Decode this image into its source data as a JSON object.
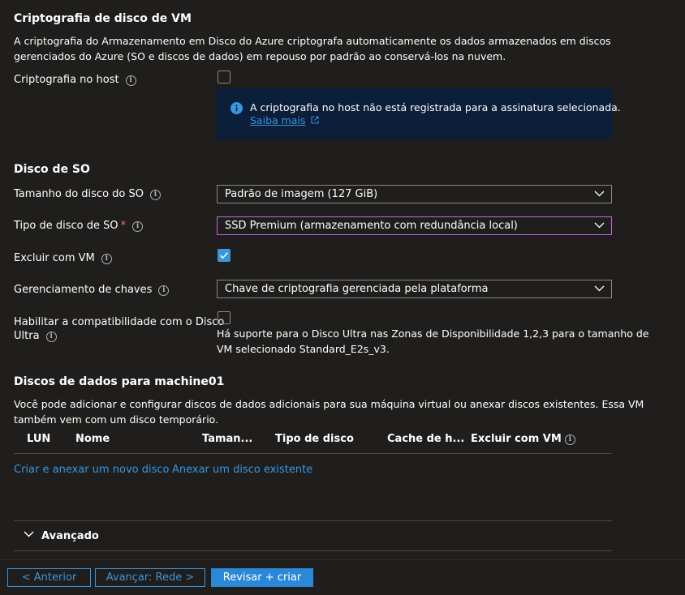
{
  "encryption": {
    "title": "Criptografia de disco de VM",
    "description_line1": "A criptografia do Armazenamento em Disco do Azure criptografa automaticamente os dados armazenados em discos",
    "description_line2": "gerenciados do Azure (SO e discos de dados) em repouso por padrão ao conservá-los na nuvem.",
    "host_label": "Criptografia no host",
    "host_checked": false,
    "info_message": "A criptografia no host não está registrada para a assinatura selecionada.",
    "info_link": "Saiba mais"
  },
  "os_disk": {
    "title": "Disco de SO",
    "size_label": "Tamanho do disco do SO",
    "size_value": "Padrão de imagem (127 GiB)",
    "type_label": "Tipo de disco de SO",
    "required_mark": "*",
    "type_value": "SSD Premium (armazenamento com redundância local)",
    "delete_label": "Excluir com VM",
    "delete_checked": true,
    "key_label": "Gerenciamento de chaves",
    "key_value": "Chave de criptografia gerenciada pela plataforma",
    "ultra_label_line1": "Habilitar a compatibilidade com o Disco",
    "ultra_label_line2": "Ultra",
    "ultra_checked": false,
    "ultra_note_line1": "Há suporte para o Disco Ultra nas Zonas de Disponibilidade 1,2,3 para o tamanho de",
    "ultra_note_line2": "VM selecionado Standard_E2s_v3."
  },
  "data_disks": {
    "title": "Discos de dados para machine01",
    "description_line1": "Você pode adicionar e configurar discos de dados adicionais para sua máquina virtual ou anexar discos existentes. Essa VM",
    "description_line2": "também vem com um disco temporário.",
    "columns": [
      "LUN",
      "Nome",
      "Taman...",
      "Tipo de disco",
      "Cache de h...",
      "Excluir com VM"
    ],
    "create_link": "Criar e anexar um novo disco",
    "attach_link": "Anexar um disco existente"
  },
  "advanced": {
    "label": "Avançado"
  },
  "footer": {
    "previous": "< Anterior",
    "next": "Avançar: Rede >",
    "review": "Revisar + criar"
  },
  "colors": {
    "background": "#1f1e1d",
    "accent": "#3a96dd",
    "info_background": "#0b1e3a",
    "focus_border": "#c566d8",
    "required": "#f1707b"
  },
  "icons": [
    "info-icon",
    "chevron-down-icon",
    "checkmark-icon",
    "external-link-icon",
    "info-circle-filled-icon"
  ]
}
